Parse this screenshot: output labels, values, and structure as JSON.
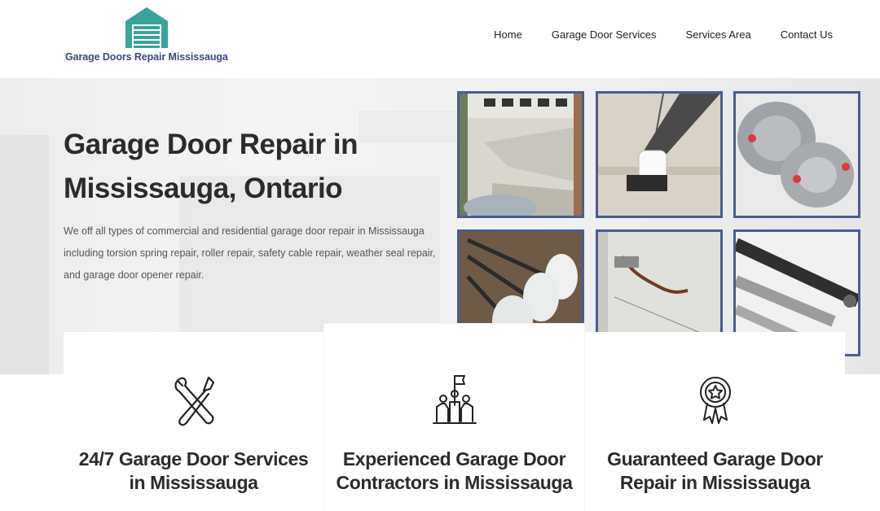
{
  "brand": {
    "name": "Garage Doors Repair Mississauga",
    "logo_icon": "garage-house-icon",
    "logo_color": "#3aa39a"
  },
  "nav": {
    "items": [
      {
        "label": "Home"
      },
      {
        "label": "Garage Door Services"
      },
      {
        "label": "Services Area"
      },
      {
        "label": "Contact Us"
      }
    ]
  },
  "hero": {
    "title_line1": "Garage Door Repair in",
    "title_line2": "Mississauga, Ontario",
    "description": "We off all types of commercial and residential garage door repair in Mississauga including torsion spring repair, roller repair, safety cable repair, weather seal repair, and garage door opener repair."
  },
  "gallery": {
    "border_color": "#4b5d8f",
    "tiles": [
      {
        "icon": "broken-garage-door-photo"
      },
      {
        "icon": "garage-door-opener-photo"
      },
      {
        "icon": "cable-drum-photo"
      },
      {
        "icon": "rollers-photo"
      },
      {
        "icon": "safety-cable-photo"
      },
      {
        "icon": "torsion-spring-photo"
      }
    ]
  },
  "features": [
    {
      "icon": "tools-icon",
      "title_line1": "24/7 Garage Door Services",
      "title_line2": "in Mississauga"
    },
    {
      "icon": "team-flag-icon",
      "title_line1": "Experienced Garage Door",
      "title_line2": "Contractors in Mississauga"
    },
    {
      "icon": "award-badge-icon",
      "title_line1": "Guaranteed Garage Door",
      "title_line2": "Repair in Mississauga"
    }
  ]
}
